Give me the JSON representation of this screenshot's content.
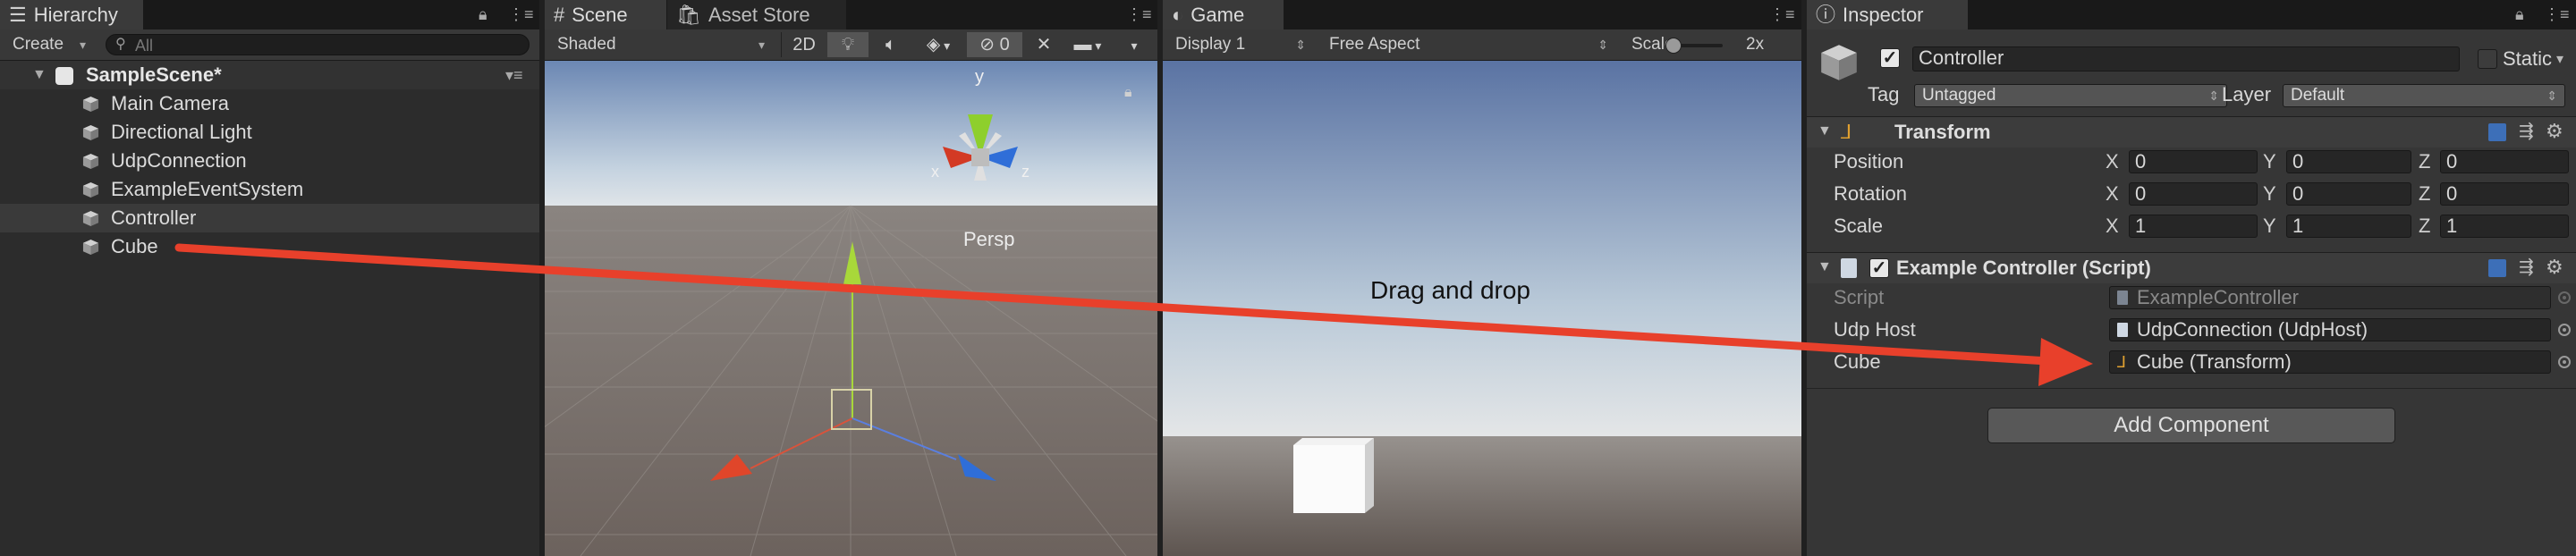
{
  "hierarchy": {
    "tab_label": "Hierarchy",
    "create_label": "Create",
    "search_placeholder": "All",
    "scene_name": "SampleScene*",
    "items": [
      {
        "label": "Main Camera"
      },
      {
        "label": "Directional Light"
      },
      {
        "label": "UdpConnection"
      },
      {
        "label": "ExampleEventSystem"
      },
      {
        "label": "Controller",
        "selected": true
      },
      {
        "label": "Cube"
      }
    ]
  },
  "scene": {
    "tab_label": "Scene",
    "asset_store_tab_label": "Asset Store",
    "shading_mode": "Shaded",
    "mode_2d_label": "2D",
    "hidden_count": "0",
    "persp_label": "Persp",
    "gizmo_y_label": "y",
    "gizmo_x_label": "x",
    "gizmo_z_label": "z"
  },
  "game": {
    "tab_label": "Game",
    "display_label": "Display 1",
    "aspect_label": "Free Aspect",
    "scale_label": "Scale",
    "scale_value": "2x",
    "annotation": "Drag and drop"
  },
  "inspector": {
    "tab_label": "Inspector",
    "object_name": "Controller",
    "static_label": "Static",
    "tag_label": "Tag",
    "tag_value": "Untagged",
    "layer_label": "Layer",
    "layer_value": "Default",
    "transform": {
      "title": "Transform",
      "rows": [
        {
          "label": "Position",
          "x": "0",
          "y": "0",
          "z": "0"
        },
        {
          "label": "Rotation",
          "x": "0",
          "y": "0",
          "z": "0"
        },
        {
          "label": "Scale",
          "x": "1",
          "y": "1",
          "z": "1"
        }
      ],
      "axis_x": "X",
      "axis_y": "Y",
      "axis_z": "Z"
    },
    "script_component": {
      "title": "Example Controller (Script)",
      "script_label": "Script",
      "script_value": "ExampleController",
      "udp_host_label": "Udp Host",
      "udp_host_value": "UdpConnection (UdpHost)",
      "cube_label": "Cube",
      "cube_value": "Cube (Transform)"
    },
    "add_component_label": "Add Component"
  },
  "colors": {
    "arrow": "#e8402b",
    "accent_blue": "#3d6fb8",
    "gizmo_green": "#8ecf2c",
    "gizmo_red": "#d33a24",
    "gizmo_blue": "#2f6ed8"
  }
}
